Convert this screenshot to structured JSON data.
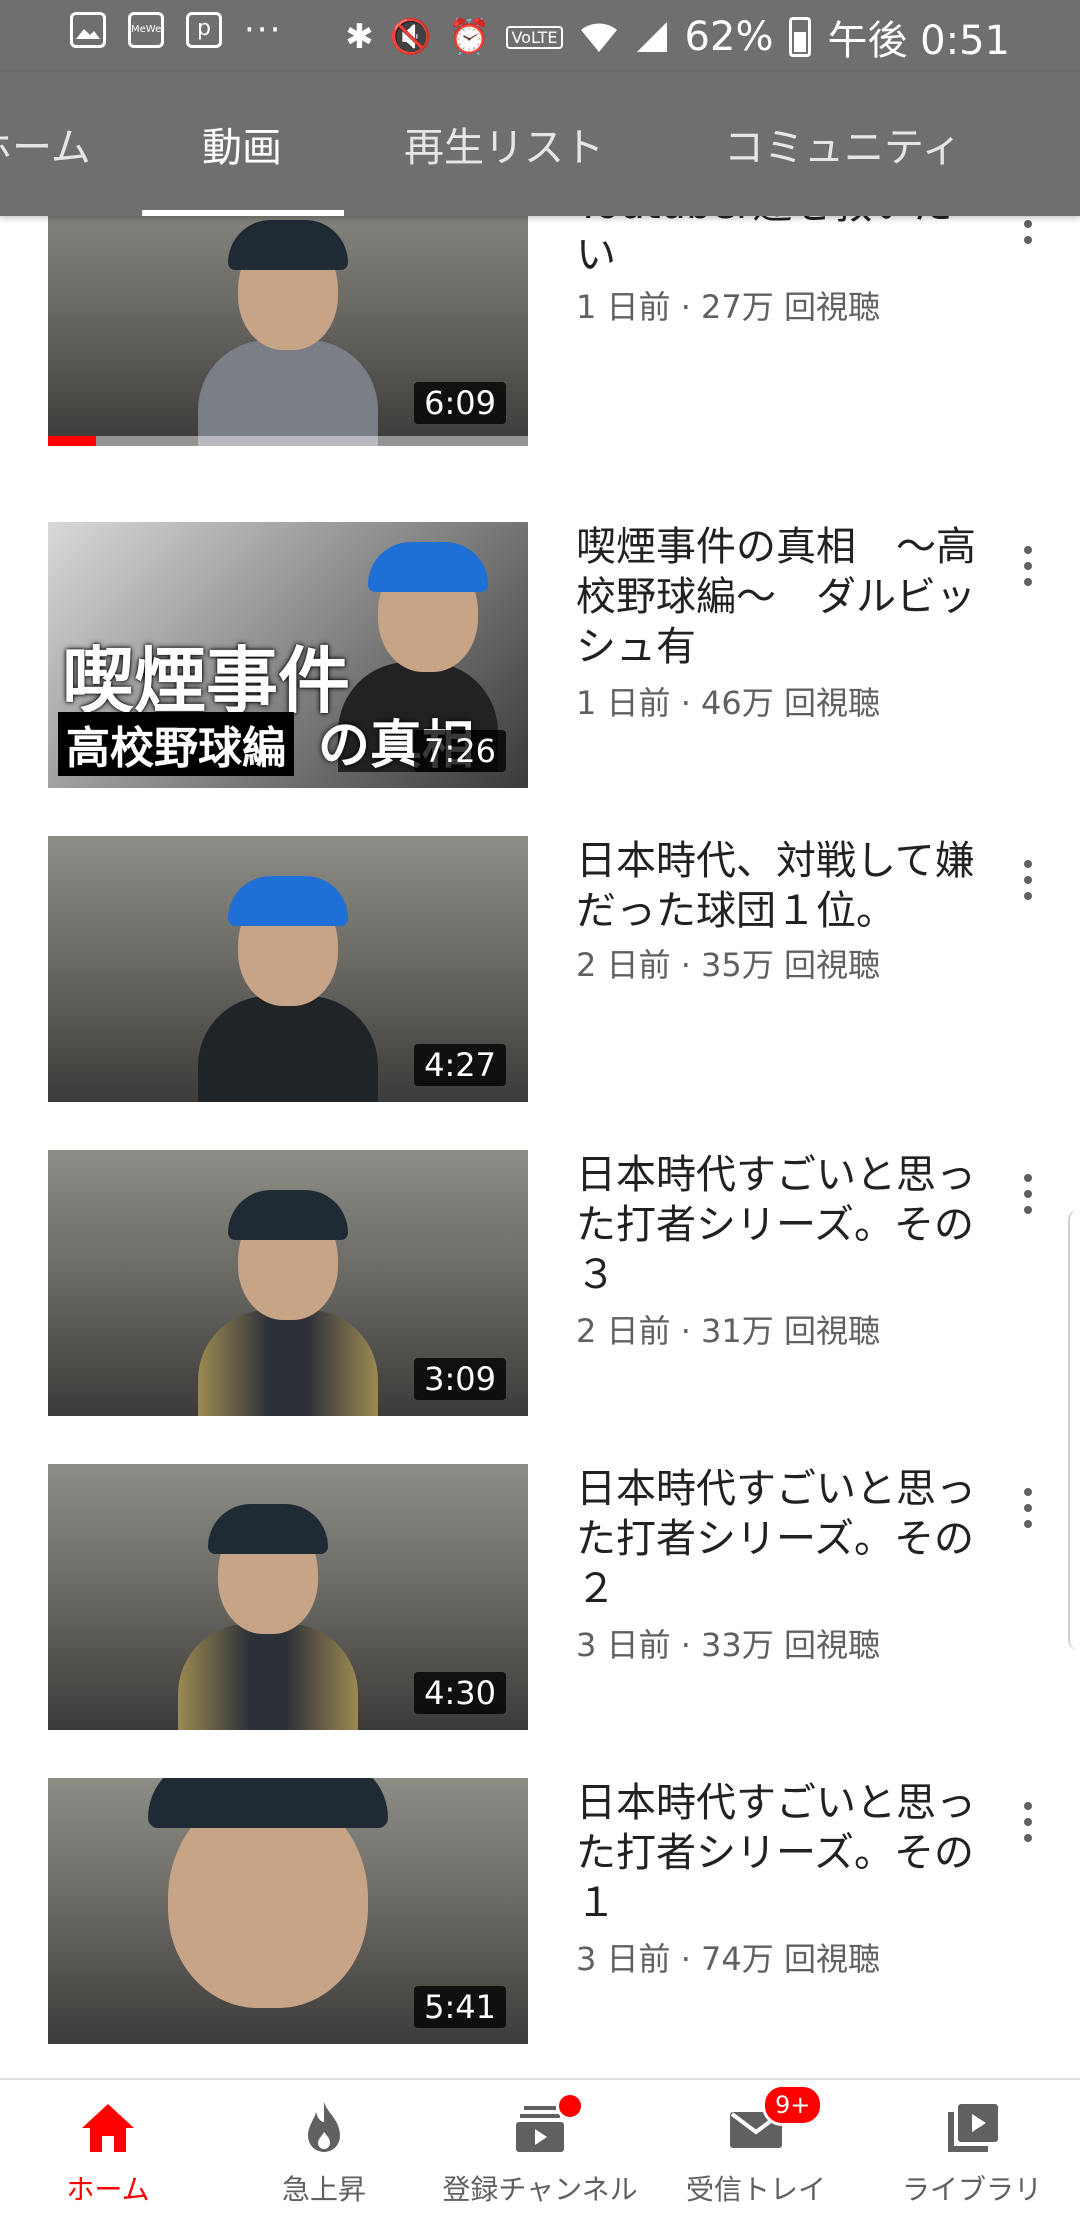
{
  "status_bar": {
    "battery": "62%",
    "time": "午後 0:51",
    "icons": [
      "image-icon",
      "mewe-icon",
      "picsart-icon",
      "more-icon",
      "bluetooth-icon",
      "mute-icon",
      "alarm-icon",
      "volte-icon",
      "wifi-icon",
      "signal-icon",
      "battery-icon"
    ],
    "more": "···",
    "volte": "VoLTE"
  },
  "tabs": [
    {
      "label": "ホーム"
    },
    {
      "label": "動画"
    },
    {
      "label": "再生リスト"
    },
    {
      "label": "コミュニティ"
    }
  ],
  "active_tab": "動画",
  "videos": [
    {
      "title": "Youtuber達を救いたい",
      "meta": "1 日前 · 27万 回視聴",
      "duration": "6:09",
      "watched_progress": 0.1
    },
    {
      "title": "喫煙事件の真相　～高校野球編～　ダルビッシュ有",
      "meta": "1 日前 · 46万 回視聴",
      "duration": "7:26",
      "overlay_main": "喫煙事件",
      "overlay_sub": "高校野球編",
      "overlay_tail": "の真相"
    },
    {
      "title": "日本時代、対戦して嫌だった球団１位。",
      "meta": "2 日前 · 35万 回視聴",
      "duration": "4:27"
    },
    {
      "title": "日本時代すごいと思った打者シリーズ。その３",
      "meta": "2 日前 · 31万 回視聴",
      "duration": "3:09"
    },
    {
      "title": "日本時代すごいと思った打者シリーズ。その２",
      "meta": "3 日前 · 33万 回視聴",
      "duration": "4:30"
    },
    {
      "title": "日本時代すごいと思った打者シリーズ。その１",
      "meta": "3 日前 · 74万 回視聴",
      "duration": "5:41"
    }
  ],
  "bottom_nav": [
    {
      "label": "ホーム",
      "icon": "home-icon",
      "active": true
    },
    {
      "label": "急上昇",
      "icon": "trending-flame-icon"
    },
    {
      "label": "登録チャンネル",
      "icon": "subscriptions-icon",
      "badge_dot": true
    },
    {
      "label": "受信トレイ",
      "icon": "inbox-mail-icon",
      "badge": "9+"
    },
    {
      "label": "ライブラリ",
      "icon": "library-icon"
    }
  ],
  "colors": {
    "accent": "#ff0000",
    "header_bg": "#6f6f6f",
    "meta_text": "#606060"
  }
}
